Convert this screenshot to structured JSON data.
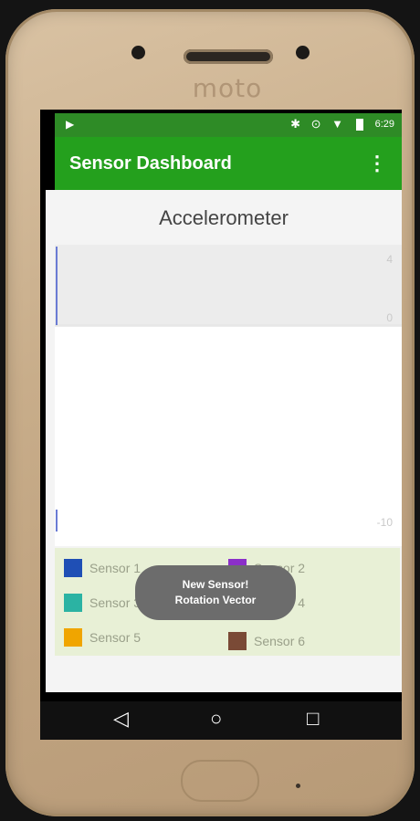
{
  "device": {
    "brand": "moto"
  },
  "status_bar": {
    "play_icon": "play-store-icon",
    "icons": "✱ ⊙ ▼",
    "time": "6:29"
  },
  "app_bar": {
    "title": "Sensor Dashboard",
    "menu_icon": "overflow-menu-icon",
    "color": "#24a01d"
  },
  "chart": {
    "title": "Accelerometer",
    "y_ticks": [
      "4",
      "0",
      "-10"
    ]
  },
  "chart_data": {
    "type": "line",
    "title": "Accelerometer",
    "xlabel": "",
    "ylabel": "",
    "ylim": [
      -10,
      4
    ],
    "y_ticks": [
      4,
      0,
      -10
    ],
    "series": [],
    "grid": true,
    "legend_placement": "bottom"
  },
  "legend": {
    "items": [
      {
        "label": "Sensor 1",
        "color": "#1f4fb5"
      },
      {
        "label": "Sensor 2",
        "color": "#8b2fc9"
      },
      {
        "label": "Sensor 3",
        "color": "#2bb3a3"
      },
      {
        "label": "Sensor 4",
        "color": "#6aa84f"
      },
      {
        "label": "Sensor 5",
        "color": "#f0a500"
      },
      {
        "label": "Sensor 6",
        "color": "#7a4a36"
      }
    ]
  },
  "toast": {
    "line1": "New Sensor!",
    "line2": "Rotation Vector"
  },
  "nav_bar": {
    "back": "◁",
    "home": "○",
    "recent": "□"
  }
}
